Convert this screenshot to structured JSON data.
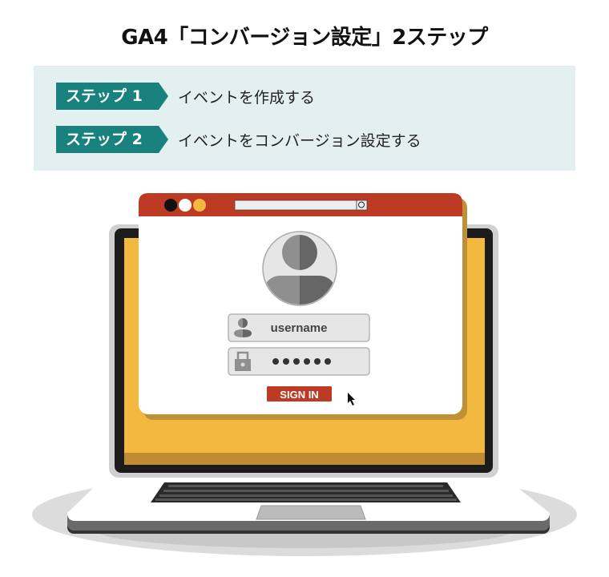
{
  "title": "GA4「コンバージョン設定」2ステップ",
  "steps": [
    {
      "badge": "ステップ 1",
      "description": "イベントを作成する"
    },
    {
      "badge": "ステップ 2",
      "description": "イベントをコンバージョン設定する"
    }
  ],
  "illustration": {
    "username_field": "username",
    "password_field": "●●●●●●",
    "sign_in_button": "SIGN IN",
    "icons": [
      "user-avatar-icon",
      "user-icon",
      "lock-icon",
      "search-icon",
      "mouse-cursor-icon"
    ]
  },
  "colors": {
    "accent": "#19827e",
    "panel": "#e4f0f0",
    "browser_bar": "#bd3a24",
    "screen": "#f3b840"
  }
}
